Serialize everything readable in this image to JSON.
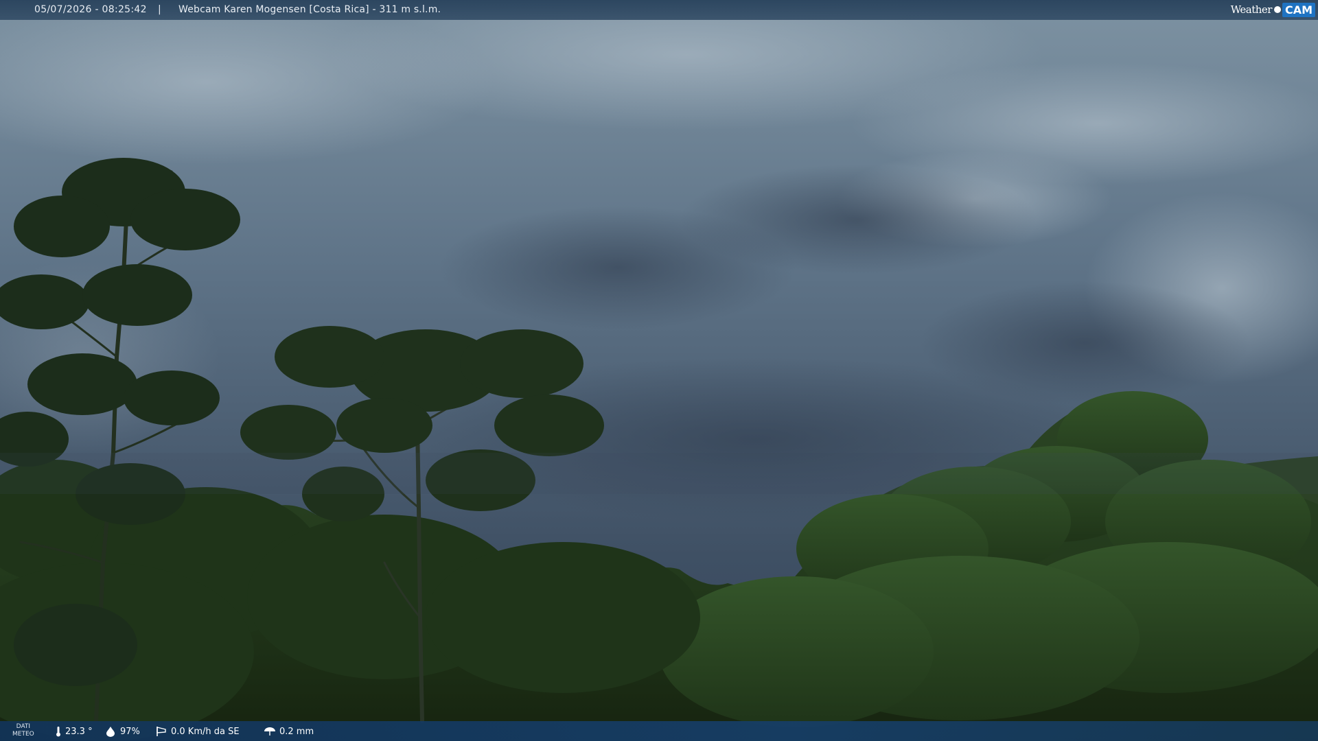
{
  "header": {
    "datetime": "05/07/2026 - 08:25:42",
    "separator": "|",
    "title": "Webcam Karen Mogensen [Costa Rica]  - 311 m s.l.m."
  },
  "logo": {
    "weather_text": "Weather",
    "cam_text": "CAM"
  },
  "weather_bar": {
    "label_line1": "DATI",
    "label_line2": "METEO",
    "temperature": "23.3 °",
    "humidity": "97%",
    "wind": "0.0 Km/h da SE",
    "rain": "0.2 mm",
    "icons": [
      "thermometer-icon",
      "humidity-drop-icon",
      "wind-sock-icon",
      "umbrella-icon"
    ]
  },
  "colors": {
    "sky_top": "#6f8596",
    "sky_bottom": "#3a4a5c",
    "forest_dark": "#1c2a18",
    "forest_mid": "#2e4a22",
    "bar_blue": "#163e68",
    "logo_blue": "#1f73c2"
  }
}
